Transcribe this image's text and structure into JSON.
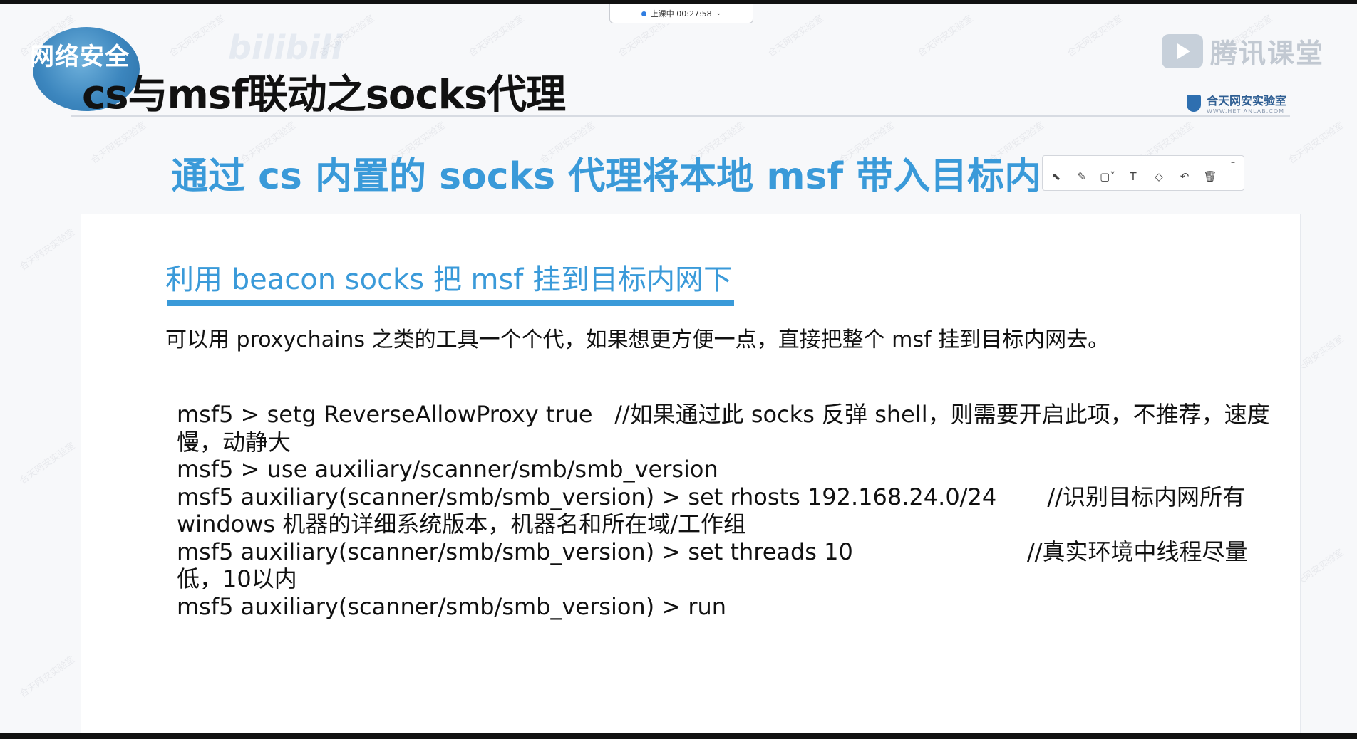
{
  "status_pill": {
    "text": "上课中 00:27:58",
    "caret": "⌄"
  },
  "header": {
    "logo_blob_text": "网络安全",
    "faint_site_logo": "bilibili",
    "slide_title": "cs与msf联动之socks代理",
    "brand": {
      "icon": "play-icon",
      "text": "腾讯课堂"
    },
    "lab": {
      "name": "合天网安实验室",
      "domain": "WWW.HETIANLAB.COM"
    }
  },
  "subtitle": "通过 cs 内置的 socks 代理将本地 msf 带入目标内网进行操作",
  "annotation_toolbar": {
    "minimize": "–",
    "tools": [
      {
        "name": "select-tool-icon",
        "glyph": "⬉"
      },
      {
        "name": "pen-tool-icon",
        "glyph": "✎"
      },
      {
        "name": "shape-tool-icon",
        "glyph": "▢˅"
      },
      {
        "name": "text-tool-icon",
        "glyph": "T"
      },
      {
        "name": "eraser-tool-icon",
        "glyph": "◇"
      },
      {
        "name": "undo-tool-icon",
        "glyph": "↶"
      },
      {
        "name": "delete-tool-icon",
        "glyph": "🗑"
      }
    ]
  },
  "content": {
    "section_heading": "利用 beacon socks 把 msf 挂到目标内网下",
    "intro": "可以用 proxychains 之类的工具一个个代，如果想更方便一点，直接把整个 msf 挂到目标内网去。",
    "code_lines": [
      "msf5 > setg ReverseAllowProxy true   //如果通过此 socks 反弹 shell，则需要开启此项，不推荐，速度",
      "慢，动静大",
      "msf5 > use auxiliary/scanner/smb/smb_version",
      "msf5 auxiliary(scanner/smb/smb_version) > set rhosts 192.168.24.0/24       //识别目标内网所有",
      "windows 机器的详细系统版本，机器名和所在域/工作组",
      "msf5 auxiliary(scanner/smb/smb_version) > set threads 10                        //真实环境中线程尽量",
      "低，10以内",
      "msf5 auxiliary(scanner/smb/smb_version) > run"
    ]
  },
  "watermark_text": "合天网安实验室"
}
